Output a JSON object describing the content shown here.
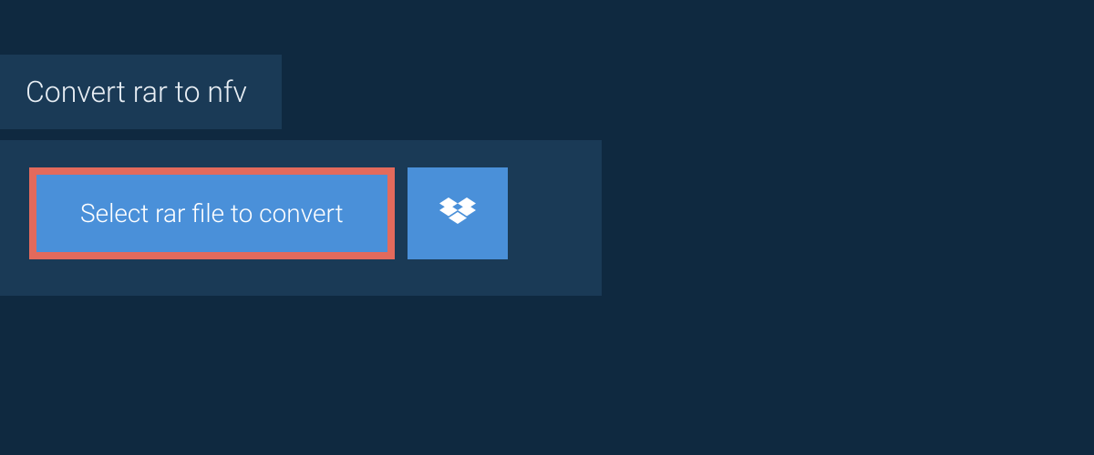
{
  "header": {
    "title": "Convert rar to nfv"
  },
  "actions": {
    "select_file_label": "Select rar file to convert"
  }
}
